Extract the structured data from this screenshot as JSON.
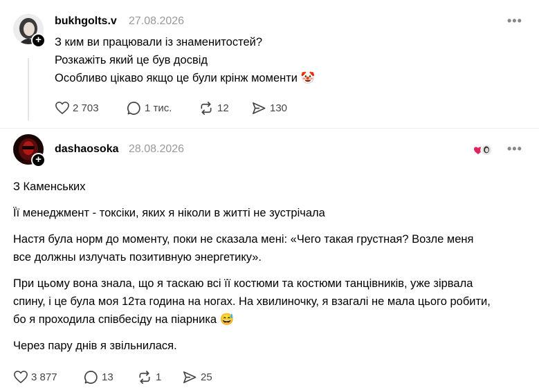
{
  "post1": {
    "username": "bukhgolts.v",
    "date": "27.08.2026",
    "lines": [
      "З ким ви працювали із знаменитостей?",
      "Розкажіть який це був досвід",
      "Особливо цікаво якщо це були крінж моменти 🤡"
    ],
    "stats": {
      "likes": "2 703",
      "comments": "1 тис.",
      "reposts": "12",
      "shares": "130"
    }
  },
  "post2": {
    "username": "dashaosoka",
    "date": "28.08.2026",
    "paragraphs": [
      "З Каменських",
      "Її менеджмент - токсіки, яких я ніколи в житті не зустрічала",
      "Настя була норм до моменту, поки не сказала мені: «Чего такая грустная? Возле меня все должны излучать позитивную энергетику».",
      "При цьому вона знала, що я таскаю всі її костюми та костюми танцівників, уже зірвала спину, і це була моя 12та година на ногах. На хвилиночку, я взагалі не мала цього робити, бо я проходила співбесіду на піарника 😅",
      "Через пару днів я звільнилася."
    ],
    "stats": {
      "likes": "3 877",
      "comments": "13",
      "reposts": "1",
      "shares": "25"
    }
  },
  "ui": {
    "more": "•••",
    "plus": "+"
  }
}
